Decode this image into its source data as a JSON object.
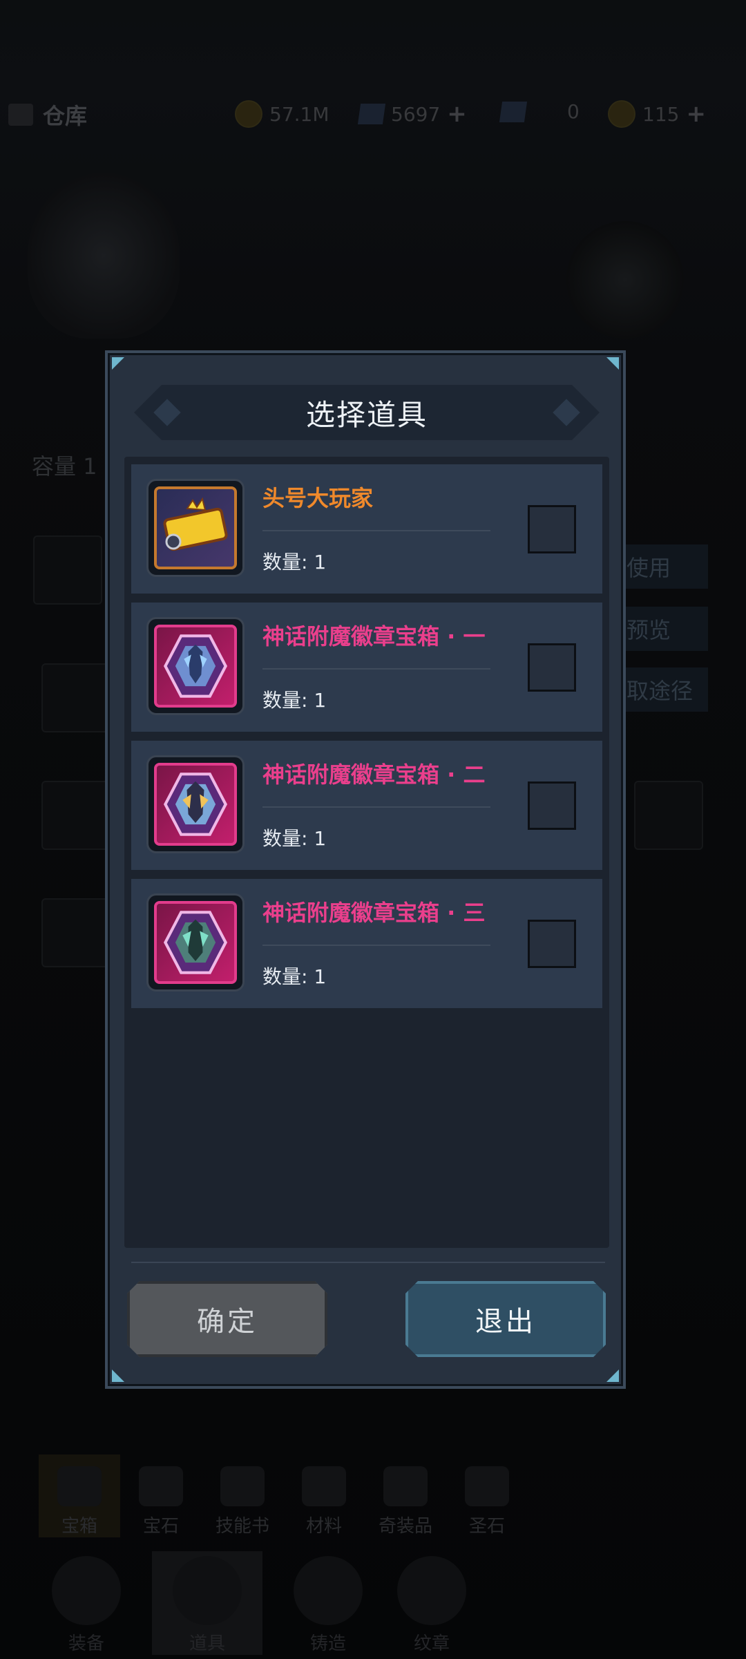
{
  "background": {
    "warehouse_title": "仓库",
    "resources": [
      {
        "name": "coin-icon",
        "value": "57.1M"
      },
      {
        "name": "gem-icon",
        "value": "5697"
      },
      {
        "name": "crystal-icon",
        "value": "0"
      },
      {
        "name": "ticket-icon",
        "value": "115"
      }
    ],
    "capacity_label": "容量 1",
    "side_buttons": [
      "使用",
      "预览",
      "取途径"
    ],
    "bottom_tabs": [
      "宝箱",
      "宝石",
      "技能书",
      "材料",
      "奇装品",
      "圣石"
    ],
    "nav": [
      "装备",
      "道具",
      "铸造",
      "纹章"
    ]
  },
  "dialog": {
    "title": "选择道具",
    "items": [
      {
        "name": "头号大玩家",
        "qty": "数量: 1",
        "color": "#f0892b",
        "icon": "gold-badge-icon"
      },
      {
        "name": "神话附魔徽章宝箱 · 一",
        "qty": "数量: 1",
        "color": "#ea3f8c",
        "icon": "mythic-badge-chest-icon"
      },
      {
        "name": "神话附魔徽章宝箱 · 二",
        "qty": "数量: 1",
        "color": "#ea3f8c",
        "icon": "mythic-badge-chest-icon"
      },
      {
        "name": "神话附魔徽章宝箱 · 三",
        "qty": "数量: 1",
        "color": "#ea3f8c",
        "icon": "mythic-badge-chest-icon"
      }
    ],
    "confirm_label": "确定",
    "exit_label": "退出"
  }
}
